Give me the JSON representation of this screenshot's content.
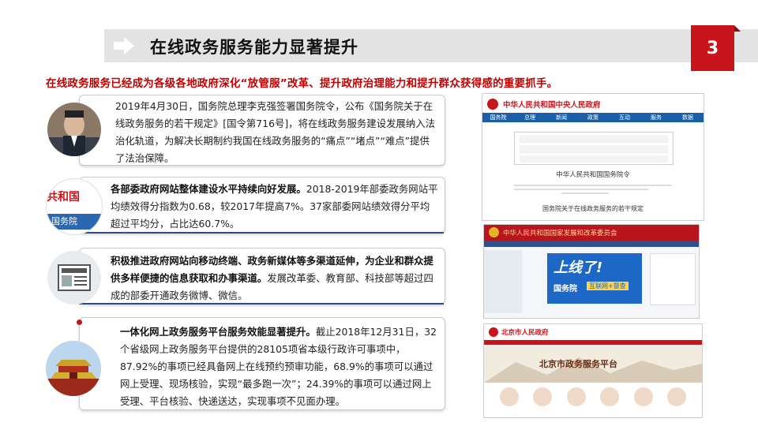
{
  "header": {
    "title": "在线政务服务能力显著提升",
    "page_number": "3"
  },
  "subtitle": "在线政务服务已经成为各级各地政府深化“放管服”改革、提升政府治理能力和提升群众获得感的重要抓手。",
  "cards": [
    {
      "bold": "",
      "text": "2019年4月30日，国务院总理李克强签署国务院令，公布《国务院关于在线政务服务的若干规定》[国令第716号]，将在线政务服务建设发展纳入法治化轨道，为解决长期制约我国在线政务服务的“痛点”“堵点”“难点”提供了法治保障。"
    },
    {
      "bold": "各部委政府网站整体建设水平持续向好发展。",
      "text": "2018-2019年部委政务网站平均绩效得分指数为0.68，较2017年提高7%。37家部委网站绩效得分平均超过平均分，占比达60.7%。"
    },
    {
      "bold": "积极推进政府网站向移动终端、政务新媒体等多渠道延伸，为企业和群众提供多样便捷的信息获取和办事渠道。",
      "text": "发展改革委、教育部、科技部等超过四成的部委开通政务微博、微信。"
    },
    {
      "bold": "一体化网上政务服务平台服务效能显著提升。",
      "text": "截止2018年12月31日，32个省级网上政务服务平台提供的28105项省本级行政许可事项中，87.92%的事项已经具备网上在线预约预审功能，68.9%的事项可以通过网上受理、现场核验，实现“最多跑一次”；24.39%的事项可以通过网上受理、平台核验、快递送达，实现事项不见面办理。"
    }
  ],
  "icons": {
    "card2_text_top": "共和国",
    "card2_text_bottom": "国务院"
  },
  "screenshots": {
    "gov": {
      "site_title": "中华人民共和国中央人民政府",
      "nav": [
        "国务院",
        "总理",
        "新闻",
        "政策",
        "互动",
        "服务",
        "数据"
      ],
      "doc_title": "中华人民共和国国务院令",
      "doc_sub": "国务院关于在线政务服务的若干规定"
    },
    "ndrc": {
      "site_title": "中华人民共和国国家发展和改革委员会",
      "banner_big": "上线了!",
      "banner_org": "国务院",
      "banner_tag": "互联网+督查"
    },
    "beijing": {
      "site_title": "北京市人民政府",
      "banner_text": "北京市政务服务平台"
    }
  },
  "colors": {
    "accent": "#c8141b",
    "subtitle": "#c00000",
    "card_line": "#2e4a8c"
  }
}
